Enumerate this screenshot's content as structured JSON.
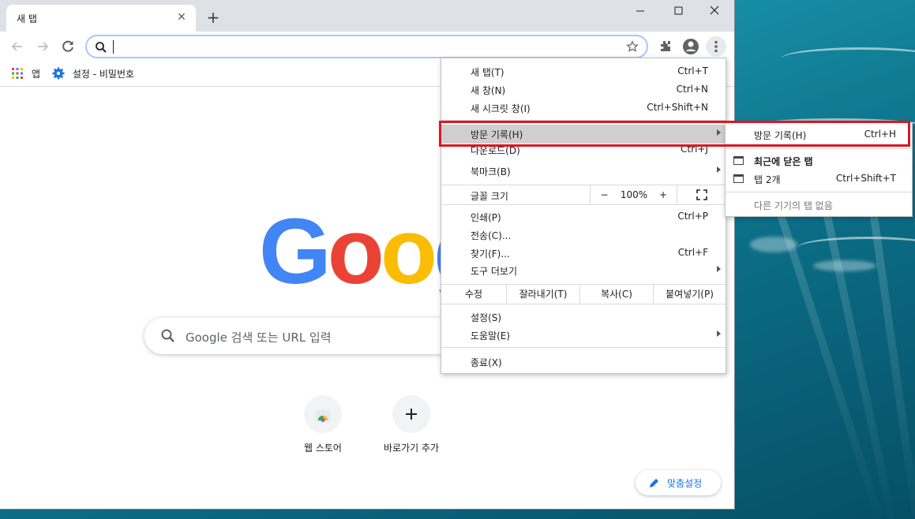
{
  "browser": {
    "tab_title": "새 탭",
    "bookmarks": {
      "apps": "앱",
      "settings_passwords": "설정 - 비밀번호"
    }
  },
  "ntp": {
    "search_placeholder": "Google 검색 또는 URL 입력",
    "shortcuts": [
      {
        "label": "웹 스토어"
      },
      {
        "label": "바로가기 추가"
      }
    ],
    "customize_label": "맞춤설정"
  },
  "menu": {
    "new_tab": {
      "label": "새 탭(T)",
      "shortcut": "Ctrl+T"
    },
    "new_window": {
      "label": "새 창(N)",
      "shortcut": "Ctrl+N"
    },
    "incognito": {
      "label": "새 시크릿 창(I)",
      "shortcut": "Ctrl+Shift+N"
    },
    "history": {
      "label": "방문 기록(H)"
    },
    "downloads": {
      "label": "다운로드(D)",
      "shortcut": "Ctrl+J"
    },
    "bookmarks": {
      "label": "북마크(B)"
    },
    "zoom": {
      "label": "글꼴 크기",
      "minus": "−",
      "value": "100%",
      "plus": "+"
    },
    "print": {
      "label": "인쇄(P)",
      "shortcut": "Ctrl+P"
    },
    "cast": {
      "label": "전송(C)..."
    },
    "find": {
      "label": "찾기(F)...",
      "shortcut": "Ctrl+F"
    },
    "more_tools": {
      "label": "도구 더보기"
    },
    "edit": {
      "label": "수정",
      "cut": "잘라내기(T)",
      "copy": "복사(C)",
      "paste": "붙여넣기(P)"
    },
    "settings": {
      "label": "설정(S)"
    },
    "help": {
      "label": "도움말(E)"
    },
    "exit": {
      "label": "종료(X)"
    }
  },
  "submenu": {
    "history": {
      "label": "방문 기록(H)",
      "shortcut": "Ctrl+H"
    },
    "recently_closed": {
      "label": "최근에 닫은 탭"
    },
    "tabs_2": {
      "label": "탭 2개",
      "shortcut": "Ctrl+Shift+T"
    },
    "no_other_devices": {
      "label": "다른 기기의 탭 없음"
    }
  },
  "colors": {
    "highlight_border": "#e0161f",
    "google_blue": "#4285f4",
    "google_red": "#ea4335",
    "google_yellow": "#fbbc05",
    "google_green": "#34a853"
  }
}
